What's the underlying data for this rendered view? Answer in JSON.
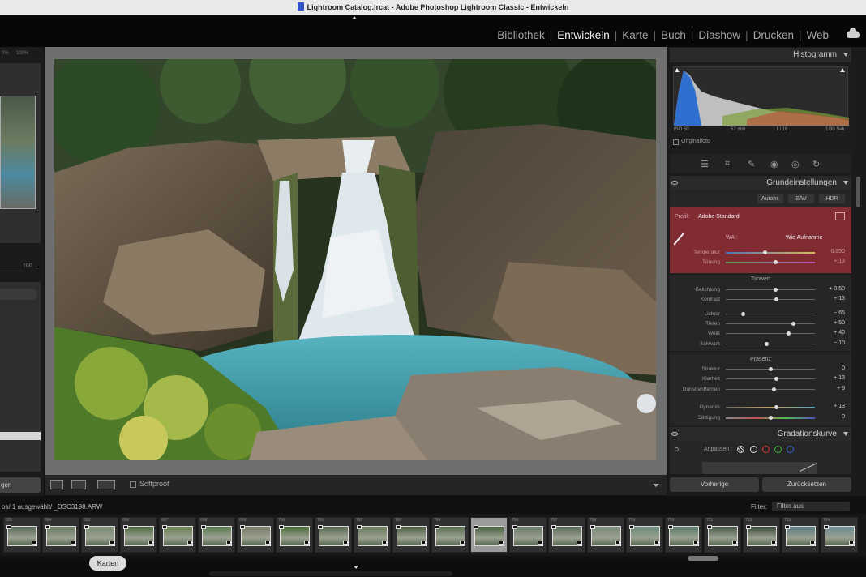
{
  "window": {
    "title": "Lightroom Catalog.lrcat - Adobe Photoshop Lightroom Classic - Entwickeln"
  },
  "modules": [
    {
      "label": "Bibliothek",
      "active": false
    },
    {
      "label": "Entwickeln",
      "active": true
    },
    {
      "label": "Karte",
      "active": false
    },
    {
      "label": "Buch",
      "active": false
    },
    {
      "label": "Diashow",
      "active": false
    },
    {
      "label": "Drucken",
      "active": false
    },
    {
      "label": "Web",
      "active": false
    }
  ],
  "left": {
    "zoom_a": "0%",
    "zoom_b": "100%",
    "slider_value": "100",
    "button_label": "gen"
  },
  "toolbar": {
    "softproof_label": "Softproof"
  },
  "histogram": {
    "title": "Histogramm",
    "iso": "ISO 50",
    "focal": "57 mm",
    "aperture": "f / 16",
    "shutter": "1/30 Sek.",
    "original_label": "Originalfoto"
  },
  "basic": {
    "title": "Grundeinstellungen",
    "btn_auto": "Autom.",
    "btn_bw": "S/W",
    "btn_hdr": "HDR",
    "profile_label": "Profil:",
    "profile_value": "Adobe Standard",
    "wb_label": "WA :",
    "wb_value": "Wie Aufnahme",
    "temp_label": "Temperatur",
    "temp_value": "6.850",
    "tint_label": "Tönung",
    "tint_value": "+ 13",
    "tone_title": "Tonwert",
    "exposure_label": "Belichtung",
    "exposure_value": "+ 0,50",
    "contrast_label": "Kontrast",
    "contrast_value": "+ 13",
    "highlights_label": "Lichter",
    "highlights_value": "− 65",
    "shadows_label": "Tiefen",
    "shadows_value": "+ 50",
    "whites_label": "Weiß",
    "whites_value": "+ 40",
    "blacks_label": "Schwarz",
    "blacks_value": "− 10",
    "presence_title": "Präsenz",
    "texture_label": "Struktur",
    "texture_value": "0",
    "clarity_label": "Klarheit",
    "clarity_value": "+ 13",
    "dehaze_label": "Dunst entfernen",
    "dehaze_value": "+ 9",
    "vibrance_label": "Dynamik",
    "vibrance_value": "+ 13",
    "saturation_label": "Sättigung",
    "saturation_value": "0"
  },
  "curve": {
    "title": "Gradationskurve",
    "adjust_label": "Anpassen :"
  },
  "buttons": {
    "previous": "Vorherige",
    "reset": "Zurücksetzen"
  },
  "filmstrip_bar": {
    "path": "os/ 1 ausgewählt/ _DSC3198.ARW",
    "filter_label": "Filter:",
    "filter_value": "Filter aus"
  },
  "filmstrip": [
    {
      "num": "695",
      "selected": false
    },
    {
      "num": "694",
      "selected": false
    },
    {
      "num": "693",
      "selected": false
    },
    {
      "num": "696",
      "selected": false
    },
    {
      "num": "697",
      "selected": false
    },
    {
      "num": "698",
      "selected": false
    },
    {
      "num": "699",
      "selected": false
    },
    {
      "num": "700",
      "selected": false
    },
    {
      "num": "701",
      "selected": false
    },
    {
      "num": "702",
      "selected": false
    },
    {
      "num": "703",
      "selected": false
    },
    {
      "num": "704",
      "selected": false
    },
    {
      "num": "705",
      "selected": true
    },
    {
      "num": "706",
      "selected": false
    },
    {
      "num": "707",
      "selected": false
    },
    {
      "num": "708",
      "selected": false
    },
    {
      "num": "709",
      "selected": false
    },
    {
      "num": "710",
      "selected": false
    },
    {
      "num": "711",
      "selected": false
    },
    {
      "num": "712",
      "selected": false
    },
    {
      "num": "713",
      "selected": false
    },
    {
      "num": "714",
      "selected": false
    }
  ],
  "tooltip": {
    "text": "Karten"
  },
  "colors": {
    "accent_red": "#9a2f3a",
    "panel": "#262626",
    "active_text": "#f2f2f2"
  }
}
